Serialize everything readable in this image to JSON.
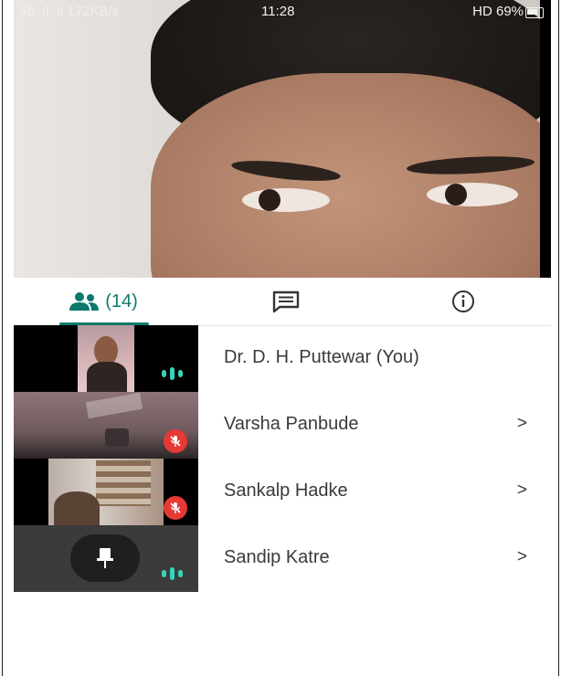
{
  "status_bar": {
    "left": "46 .ıl .ıl 172KB/s",
    "time": "11:28",
    "right": "HD 69%"
  },
  "tabs": {
    "people_count": "(14)",
    "active": "people",
    "people_icon": "people-icon",
    "chat_icon": "chat-icon",
    "info_icon": "info-icon"
  },
  "participants": [
    {
      "name": "Dr. D. H. Puttewar (You)",
      "audio": "speaking",
      "chevron": ""
    },
    {
      "name": "Varsha Panbude",
      "audio": "muted",
      "chevron": ">"
    },
    {
      "name": "Sankalp Hadke",
      "audio": "muted",
      "chevron": ">"
    },
    {
      "name": "Sandip Katre",
      "audio": "speaking",
      "chevron": ">"
    }
  ],
  "colors": {
    "accent": "#0b7a6c",
    "audio_active": "#35d3bb",
    "muted_badge": "#e53935"
  }
}
